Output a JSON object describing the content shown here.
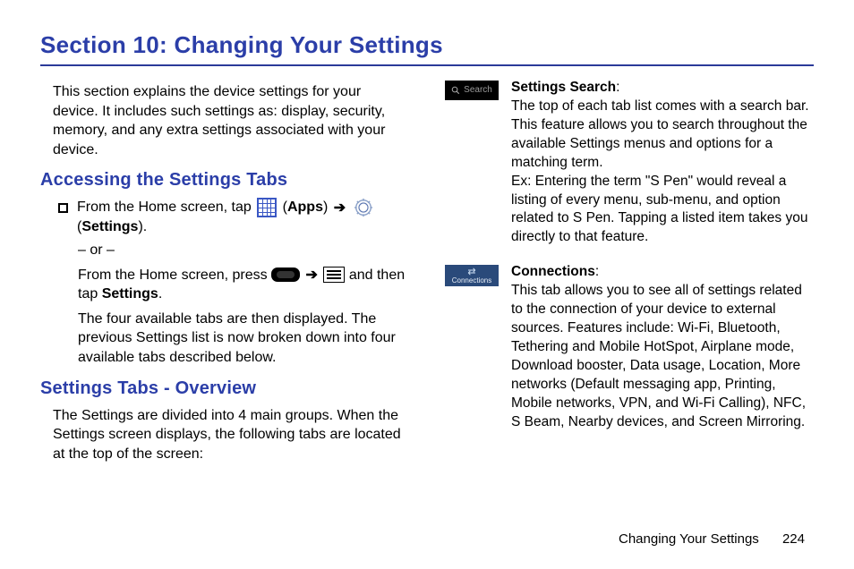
{
  "title": "Section 10: Changing Your Settings",
  "intro": "This section explains the device settings for your device. It includes such settings as: display, security, memory, and any extra settings associated with your device.",
  "h_access": "Accessing the Settings Tabs",
  "step1_a": "From the Home screen, tap ",
  "step1_apps": "Apps",
  "step1_settings": "Settings",
  "or": "– or –",
  "step2_a": "From the Home screen, press ",
  "step2_b": " and then tap ",
  "step2_settings": "Settings",
  "step2_after": ".",
  "tabs_note": "The four available tabs are then displayed. The previous Settings list is now broken down into four available tabs described below.",
  "h_overview": "Settings Tabs - Overview",
  "overview_p": "The Settings are divided into 4 main groups. When the Settings screen displays, the following tabs are located at the top of the screen:",
  "chip_search": "Search",
  "search_title": "Settings Search",
  "search_body": "The top of each tab list comes with a search bar. This feature allows you to search throughout the available Settings menus and options for a matching term.",
  "search_ex": "Ex: Entering the term \"S Pen\" would reveal a listing of every menu, sub-menu, and option related to S Pen. Tapping a listed item takes you directly to that feature.",
  "chip_conn": "Connections",
  "conn_title": "Connections",
  "conn_body": "This tab allows you to see all of settings related to the connection of your device to external sources. Features include: Wi-Fi, Bluetooth, Tethering and Mobile HotSpot, Airplane mode, Download booster, Data usage, Location, More networks (Default messaging app, Printing, Mobile networks, VPN, and Wi-Fi Calling), NFC, S Beam, Nearby devices, and Screen Mirroring.",
  "footer_text": "Changing Your Settings",
  "footer_page": "224"
}
